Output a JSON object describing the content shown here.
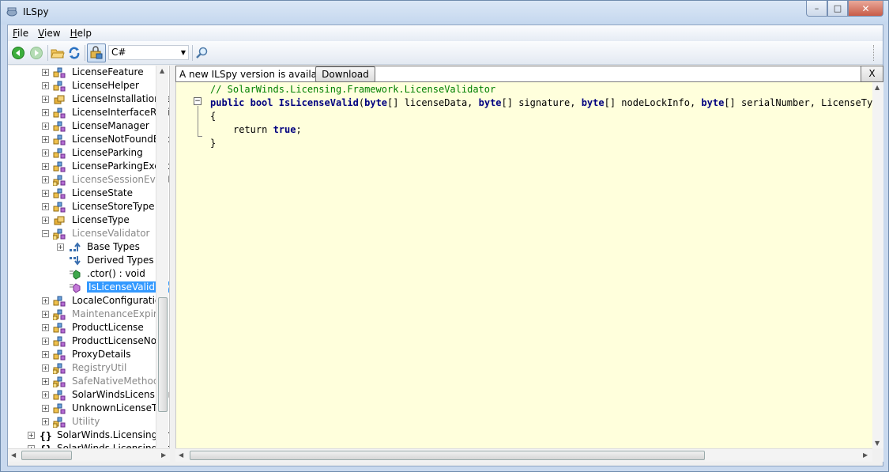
{
  "window": {
    "title": "ILSpy",
    "controls": {
      "minimize": "–",
      "maximize": "□",
      "close": "✕"
    }
  },
  "menu": {
    "items": [
      {
        "underline": "F",
        "rest": "ile"
      },
      {
        "underline": "V",
        "rest": "iew"
      },
      {
        "underline": "H",
        "rest": "elp"
      }
    ]
  },
  "toolbar": {
    "language": "C#",
    "icons": [
      "back-icon",
      "forward-icon",
      "open-folder-icon",
      "refresh-icon",
      "show-internal-icon",
      "search-icon"
    ]
  },
  "notification": {
    "text": "A new ILSpy version is available.",
    "download_label": "Download",
    "close_label": "X"
  },
  "tree": {
    "items": [
      {
        "label": "LicenseFeature",
        "icon": "class-icon",
        "grey": false
      },
      {
        "label": "LicenseHelper",
        "icon": "class-icon",
        "grey": false
      },
      {
        "label": "LicenseInstallationRe",
        "icon": "enum-icon",
        "grey": false
      },
      {
        "label": "LicenseInterfaceRevi",
        "icon": "class-icon",
        "grey": false
      },
      {
        "label": "LicenseManager",
        "icon": "class-icon",
        "grey": false
      },
      {
        "label": "LicenseNotFoundExc",
        "icon": "class-icon",
        "grey": false
      },
      {
        "label": "LicenseParking",
        "icon": "class-icon",
        "grey": false
      },
      {
        "label": "LicenseParkingExcep",
        "icon": "class-icon",
        "grey": false
      },
      {
        "label": "LicenseSessionEvent",
        "icon": "internal-class-icon",
        "grey": true
      },
      {
        "label": "LicenseState",
        "icon": "class-icon",
        "grey": false
      },
      {
        "label": "LicenseStoreType",
        "icon": "class-icon",
        "grey": false
      },
      {
        "label": "LicenseType",
        "icon": "enum-icon",
        "grey": false
      },
      {
        "label": "LicenseValidator",
        "icon": "internal-class-icon",
        "grey": true
      }
    ],
    "validator_children": [
      {
        "label": "Base Types",
        "icon": "base-types-icon"
      },
      {
        "label": "Derived Types",
        "icon": "derived-types-icon"
      },
      {
        "label": ".ctor() : void",
        "icon": "constructor-icon"
      },
      {
        "label": "IsLicenseValid(by",
        "icon": "method-icon"
      }
    ],
    "items_after": [
      {
        "label": "LocaleConfiguration",
        "icon": "class-icon",
        "grey": false
      },
      {
        "label": "MaintenanceExpired",
        "icon": "internal-class-icon",
        "grey": true
      },
      {
        "label": "ProductLicense",
        "icon": "class-icon",
        "grey": false
      },
      {
        "label": "ProductLicenseNotF",
        "icon": "class-icon",
        "grey": false
      },
      {
        "label": "ProxyDetails",
        "icon": "class-icon",
        "grey": false
      },
      {
        "label": "RegistryUtil",
        "icon": "internal-class-icon",
        "grey": true
      },
      {
        "label": "SafeNativeMethods",
        "icon": "internal-class-icon",
        "grey": true
      },
      {
        "label": "SolarWindsLicensing",
        "icon": "class-icon",
        "grey": false
      },
      {
        "label": "UnknownLicenseTyp",
        "icon": "class-icon",
        "grey": false
      },
      {
        "label": "Utility",
        "icon": "internal-class-icon",
        "grey": true
      }
    ],
    "namespaces": [
      {
        "label": "SolarWinds.Licensing.Fr",
        "icon": "namespace-icon"
      },
      {
        "label": "SolarWinds.Licensing.Fr",
        "icon": "namespace-icon"
      }
    ]
  },
  "code": {
    "comment": "// SolarWinds.Licensing.Framework.LicenseValidator",
    "sig_public": "public",
    "sig_bool": "bool",
    "sig_method": "IsLicenseValid",
    "sig_p1": "(",
    "sig_byte1": "byte",
    "sig_p2": "[] licenseData, ",
    "sig_byte2": "byte",
    "sig_p3": "[] signature, ",
    "sig_byte3": "byte",
    "sig_p4": "[] nodeLockInfo, ",
    "sig_byte4": "byte",
    "sig_p5": "[] serialNumber, LicenseType ty",
    "open_brace": "{",
    "return_kw": "return",
    "true_kw": "true",
    "semicolon": ";",
    "close_brace": "}"
  },
  "colors": {
    "editor_bg": "#ffffdc",
    "selection": "#3399ff",
    "keyword": "#0000ff",
    "comment": "#008000"
  }
}
